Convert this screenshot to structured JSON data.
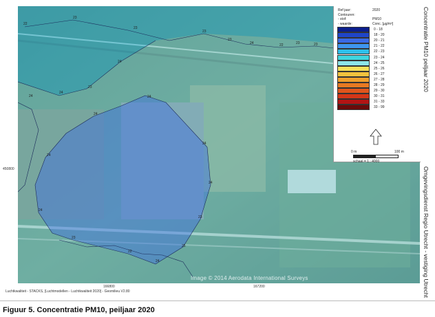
{
  "legend": {
    "meta": [
      {
        "key": "Ref jaar:",
        "value": "2020"
      },
      {
        "key": "Contouren:",
        "value": ""
      },
      {
        "key": "- stof:",
        "value": "PM10"
      },
      {
        "key": "- waarde:",
        "value": "Conc. [µg/m³]"
      }
    ],
    "classes": [
      {
        "label": "0 - 18",
        "color": "#0b1e8c"
      },
      {
        "label": "18 - 20",
        "color": "#1f45c8"
      },
      {
        "label": "20 - 21",
        "color": "#3a6ae6"
      },
      {
        "label": "21 - 22",
        "color": "#3e95ee"
      },
      {
        "label": "22 - 23",
        "color": "#2ec0ea"
      },
      {
        "label": "23 - 24",
        "color": "#3fd6e0"
      },
      {
        "label": "24 - 25",
        "color": "#8ce4e8"
      },
      {
        "label": "25 - 26",
        "color": "#f3e05a"
      },
      {
        "label": "26 - 27",
        "color": "#f2c23e"
      },
      {
        "label": "27 - 28",
        "color": "#efa02e"
      },
      {
        "label": "28 - 29",
        "color": "#e87a22"
      },
      {
        "label": "29 - 30",
        "color": "#e0561c"
      },
      {
        "label": "30 - 31",
        "color": "#d43618"
      },
      {
        "label": "31 - 33",
        "color": "#b21414"
      },
      {
        "label": "33 - 99",
        "color": "#6a0a0a"
      }
    ],
    "scale": {
      "zero": "0 m",
      "end": "100 m",
      "ratio": "schaal = 1 : 4000"
    }
  },
  "side": {
    "title": "Concentratie PM10 peiljaar 2020",
    "org": "Omgevingsdienst Regio Utrecht - vestiging Utrecht"
  },
  "axes": {
    "y_tick": "450800",
    "x_tick_1": "166800",
    "x_tick_2": "167200"
  },
  "credit": "Luchtkwaliteit - STACKS, [Luchtmodellen - Luchtkwaliteit 2020] - Geomilieu V2.80",
  "watermark": "Image © 2014 Aerodata International Surveys",
  "caption": "Figuur 5. Concentratie PM10, peiljaar 2020",
  "contour_labels": [
    "22",
    "23",
    "23",
    "23",
    "23",
    "24",
    "22",
    "23",
    "23",
    "24",
    "24",
    "23",
    "24",
    "24",
    "23",
    "24",
    "24",
    "24",
    "24",
    "23",
    "25",
    "24",
    "22",
    "23",
    "24",
    "24",
    "24"
  ]
}
